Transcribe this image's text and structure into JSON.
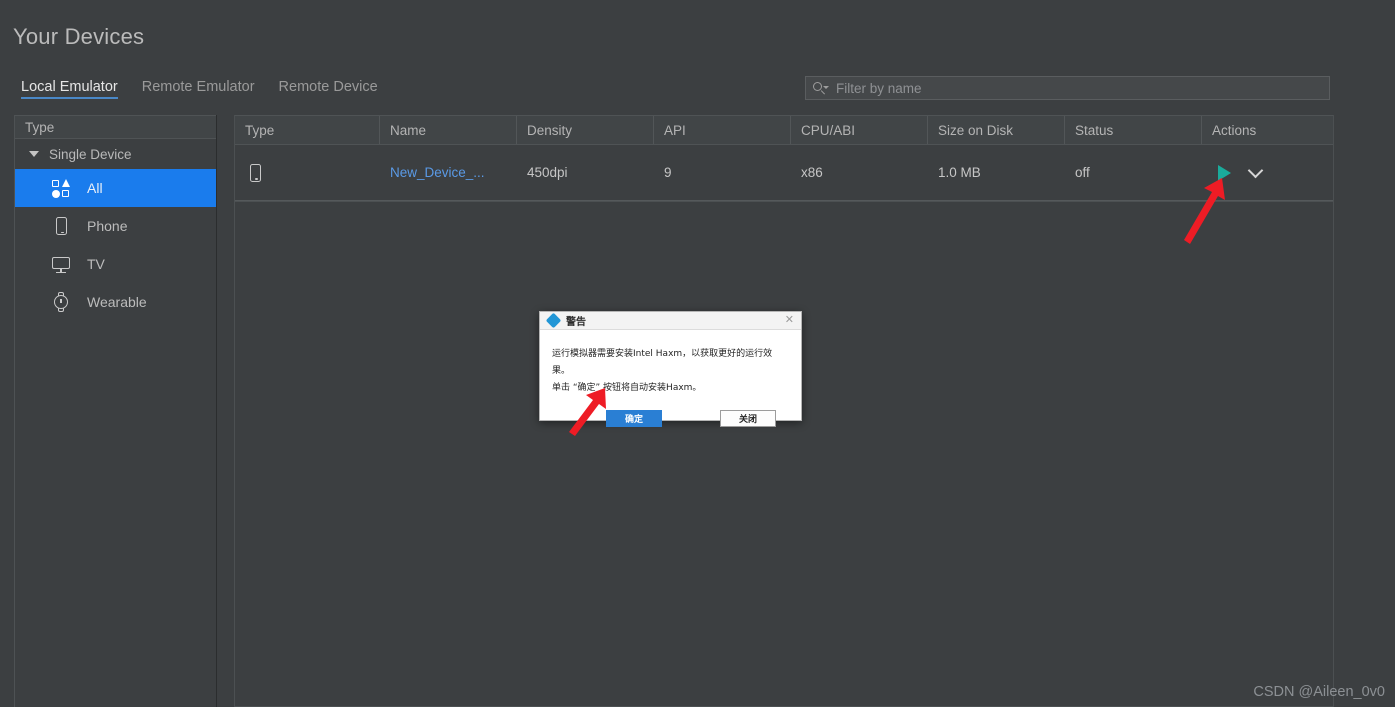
{
  "header": {
    "title": "Your Devices",
    "tabs": [
      {
        "label": "Local Emulator",
        "active": true
      },
      {
        "label": "Remote Emulator",
        "active": false
      },
      {
        "label": "Remote Device",
        "active": false
      }
    ]
  },
  "search": {
    "placeholder": "Filter by name",
    "value": "",
    "icon": "search-icon"
  },
  "sidebar": {
    "header": "Type",
    "group": {
      "label": "Single Device",
      "expanded": true
    },
    "items": [
      {
        "label": "All",
        "icon": "all-shapes-icon",
        "selected": true
      },
      {
        "label": "Phone",
        "icon": "phone-icon",
        "selected": false
      },
      {
        "label": "TV",
        "icon": "tv-icon",
        "selected": false
      },
      {
        "label": "Wearable",
        "icon": "watch-icon",
        "selected": false
      }
    ]
  },
  "table": {
    "columns": [
      "Type",
      "Name",
      "Density",
      "API",
      "CPU/ABI",
      "Size on Disk",
      "Status",
      "Actions"
    ],
    "rows": [
      {
        "type_icon": "phone-icon",
        "name": "New_Device_...",
        "density": "450dpi",
        "api": "9",
        "cpu_abi": "x86",
        "size_on_disk": "1.0 MB",
        "status": "off",
        "actions": {
          "run": "play-icon",
          "menu": "chevron-down-icon"
        }
      }
    ]
  },
  "dialog": {
    "title": "警告",
    "icon": "info-diamond-icon",
    "close_icon": "close-icon",
    "line1": "运行模拟器需要安装Intel Haxm，以获取更好的运行效果。",
    "line2": "单击 “确定” 按钮将自动安装Haxm。",
    "ok_label": "确定",
    "close_label": "关闭"
  },
  "annotations": {
    "arrow_color": "#ee1c25",
    "arrows": [
      {
        "name": "arrow-to-run-button"
      },
      {
        "name": "arrow-to-ok-button"
      }
    ]
  },
  "watermark": "CSDN @Aileen_0v0",
  "colors": {
    "background": "#3c3f41",
    "accent_blue": "#1a7ced",
    "link_blue": "#5a9ae6",
    "play_teal": "#1aab9b",
    "dialog_blue": "#2a7fd4",
    "arrow_red": "#ee1c25"
  }
}
